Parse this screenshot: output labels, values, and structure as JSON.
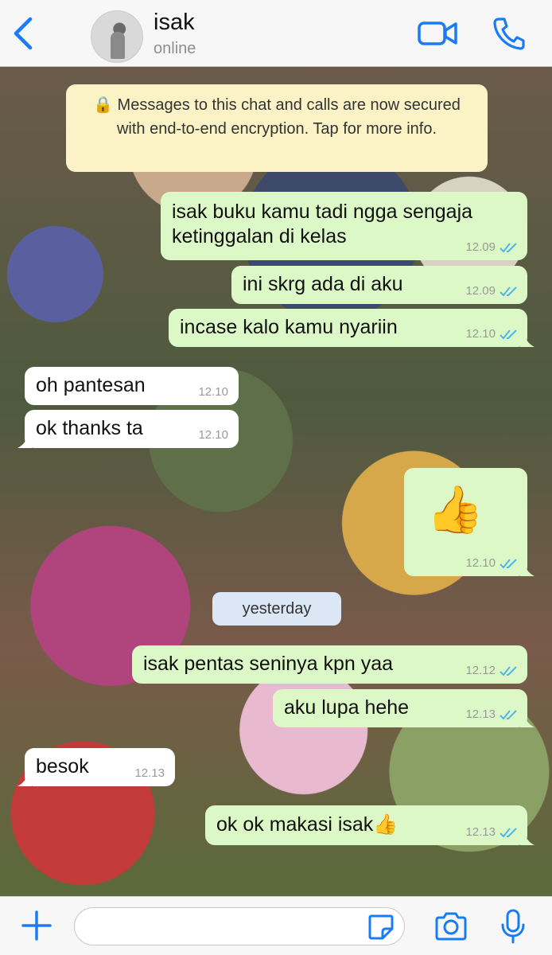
{
  "header": {
    "contact_name": "isak",
    "status": "online"
  },
  "icons": {
    "back": "chevron-left-icon",
    "video": "video-camera-icon",
    "call": "phone-icon",
    "plus": "plus-icon",
    "sticker": "sticker-icon",
    "camera": "camera-icon",
    "mic": "microphone-icon",
    "read_receipt": "double-check-icon"
  },
  "colors": {
    "accent": "#1a7cf5",
    "outgoing_bubble": "#dcf8c6",
    "incoming_bubble": "#ffffff",
    "system_notice": "#fbf3c6",
    "date_chip": "#dbe7f5",
    "read_ticks": "#4fb6ec"
  },
  "chat": {
    "encryption_notice": "🔒 Messages to this chat and calls are now secured with end-to-end encryption. Tap for more info.",
    "date_separator": "yesterday",
    "messages": [
      {
        "direction": "out",
        "text": "isak buku kamu tadi ngga sengaja",
        "text2": "ketinggalan di kelas",
        "time": "12.09"
      },
      {
        "direction": "out",
        "text": "ini skrg ada di aku",
        "time": "12.09"
      },
      {
        "direction": "out",
        "text": "incase kalo kamu nyariin",
        "time": "12.10"
      },
      {
        "direction": "in",
        "text": "oh pantesan",
        "time": "12.10"
      },
      {
        "direction": "in",
        "text": "ok thanks ta",
        "time": "12.10"
      },
      {
        "direction": "out",
        "text": "👍",
        "time": "12.10"
      },
      {
        "direction": "out",
        "text": "isak pentas seninya kpn yaa",
        "time": "12.12"
      },
      {
        "direction": "out",
        "text": "aku lupa hehe",
        "time": "12.13"
      },
      {
        "direction": "in",
        "text": "besok",
        "time": "12.13"
      },
      {
        "direction": "out",
        "text": "ok ok makasi isak👍",
        "time": "12.13"
      }
    ]
  },
  "footer": {
    "input_value": ""
  }
}
